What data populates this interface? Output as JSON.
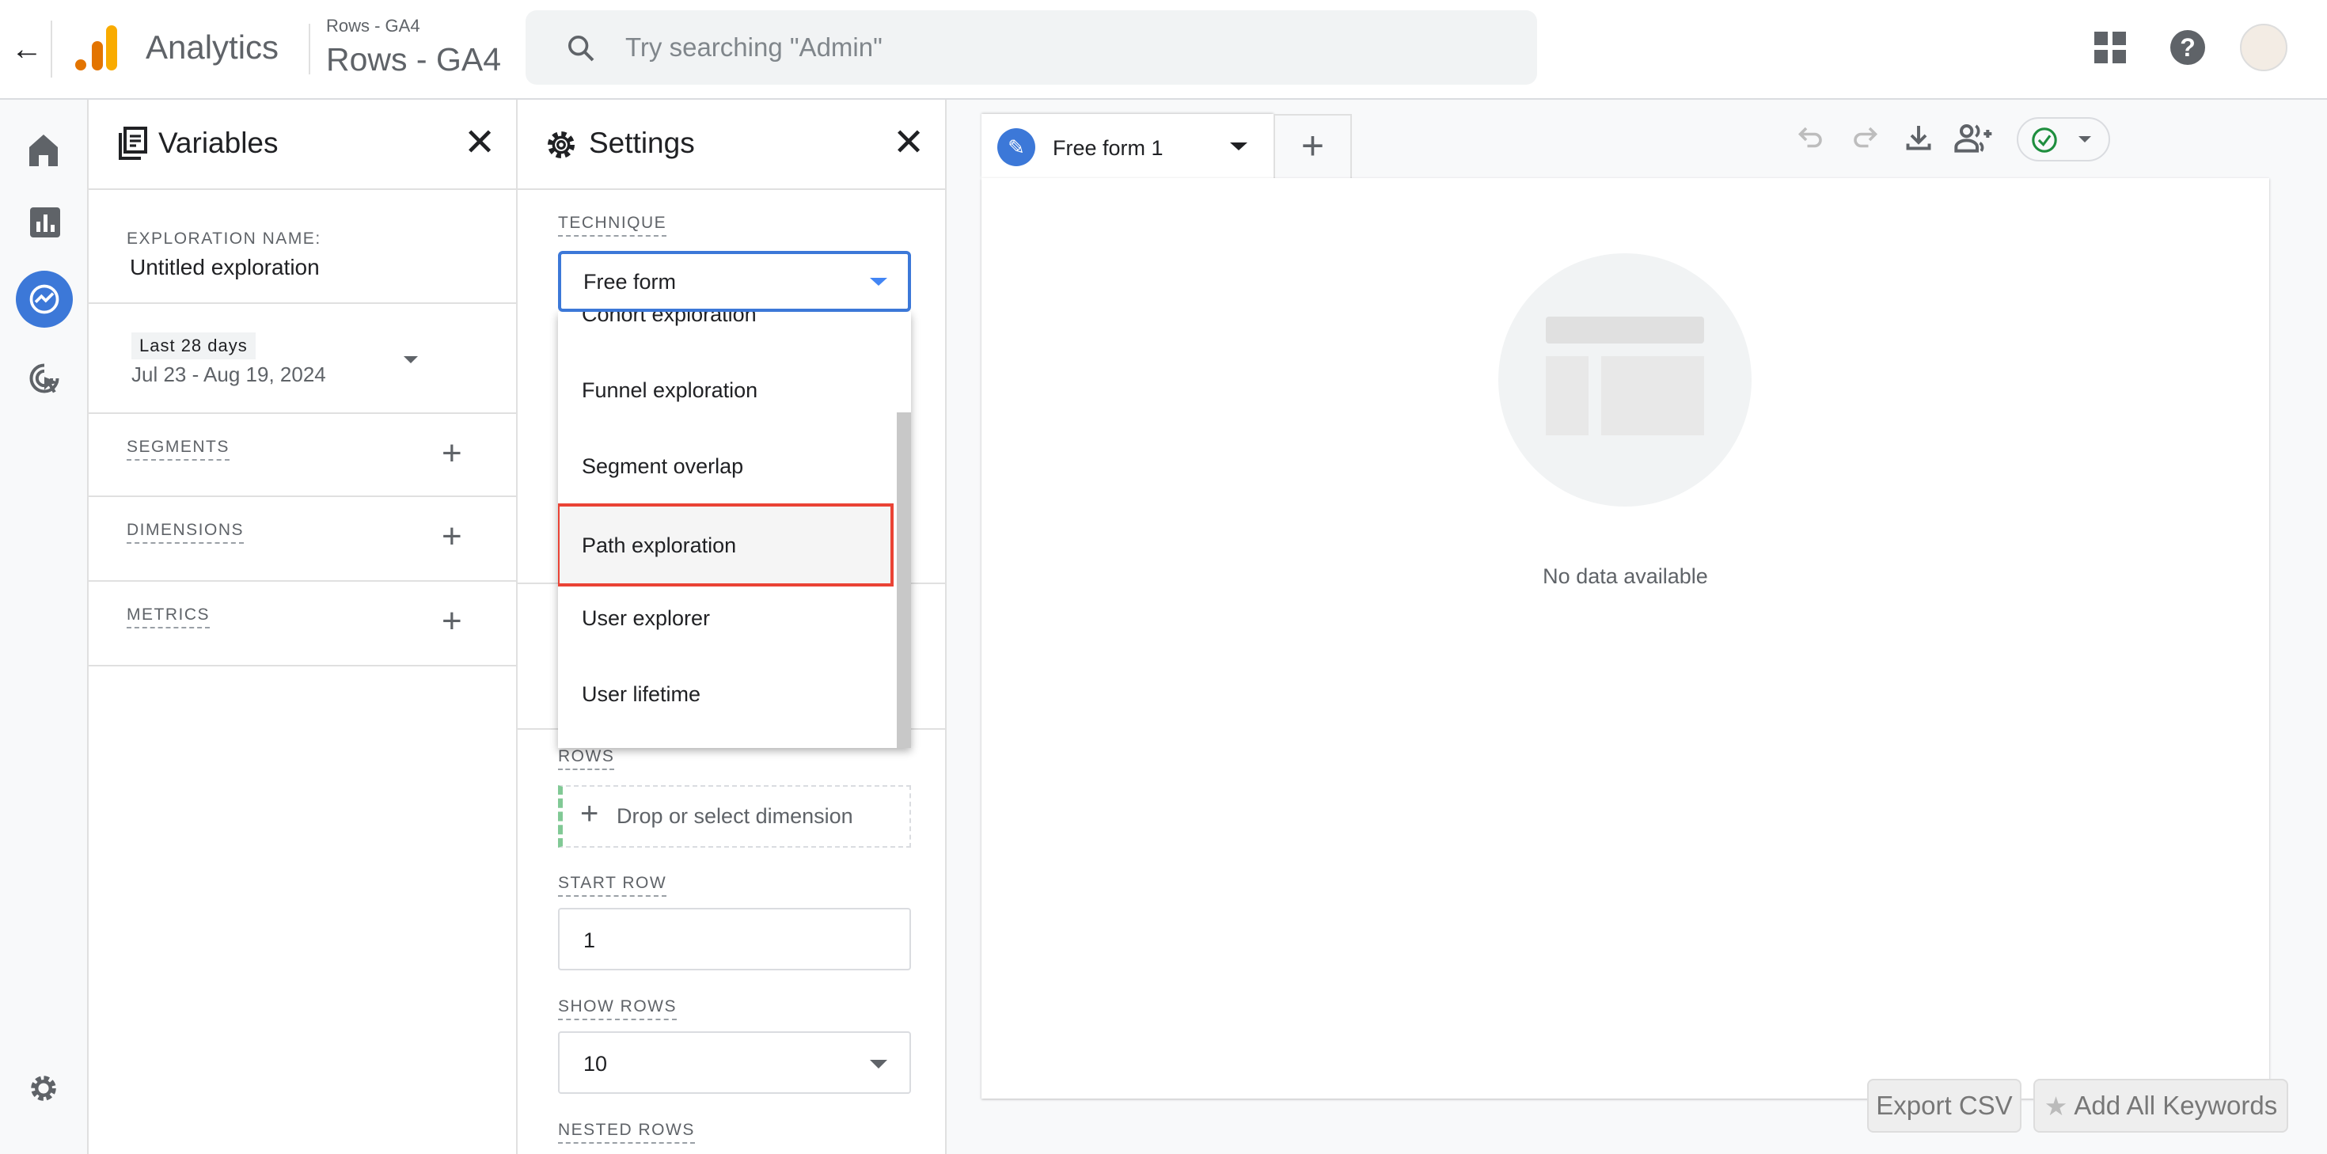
{
  "topbar": {
    "app_name": "Analytics",
    "property_small": "Rows - GA4",
    "property_large": "Rows - GA4",
    "search_placeholder": "Try searching \"Admin\""
  },
  "variables": {
    "title": "Variables",
    "exploration_name_label": "EXPLORATION NAME:",
    "exploration_name": "Untitled exploration",
    "date_preset": "Last 28 days",
    "date_range": "Jul 23 - Aug 19, 2024",
    "segments": "SEGMENTS",
    "dimensions": "DIMENSIONS",
    "metrics": "METRICS"
  },
  "settings": {
    "title": "Settings",
    "technique_label": "TECHNIQUE",
    "technique_value": "Free form",
    "options": [
      "Cohort exploration",
      "Funnel exploration",
      "Segment overlap",
      "Path exploration",
      "User explorer",
      "User lifetime"
    ],
    "highlighted_option": "Path exploration",
    "rows_label": "ROWS",
    "rows_placeholder": "Drop or select dimension",
    "start_row_label": "START ROW",
    "start_row": "1",
    "show_rows_label": "SHOW ROWS",
    "show_rows": "10",
    "nested_rows_label": "NESTED ROWS"
  },
  "tabs": [
    {
      "label": "Free form 1"
    }
  ],
  "canvas": {
    "empty_text": "No data available"
  },
  "overlay": {
    "export_csv": "Export CSV",
    "add_keywords": "Add All Keywords"
  },
  "colors": {
    "accent": "#4285f4",
    "highlight_border": "#ea4335",
    "status_check": "#1e8e3e"
  }
}
